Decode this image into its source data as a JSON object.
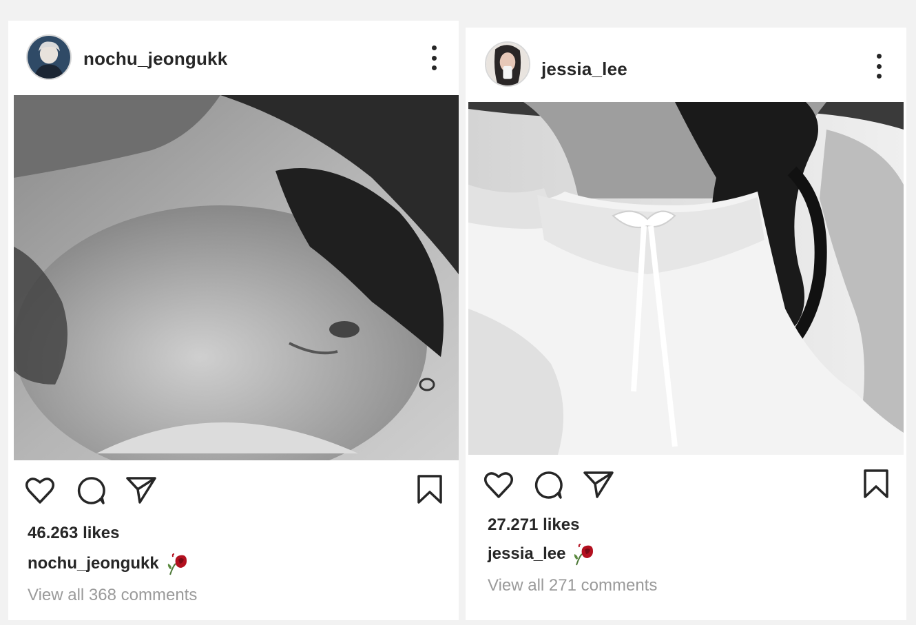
{
  "posts": [
    {
      "username": "nochu_jeongukk",
      "likes": "46.263 likes",
      "caption_user": "nochu_jeongukk",
      "caption_emoji": "wilted-rose-icon",
      "comments_link": "View all 368 comments"
    },
    {
      "username": "jessia_lee",
      "likes": "27.271 likes",
      "caption_user": "jessia_lee",
      "caption_emoji": "wilted-rose-icon",
      "comments_link": "View all 271 comments"
    }
  ],
  "icons": [
    "heart-icon",
    "comment-icon",
    "share-icon",
    "bookmark-icon",
    "more-options-icon"
  ],
  "colors": {
    "text": "#262626",
    "muted": "#9a9a9a",
    "rose": "#b3101f"
  }
}
